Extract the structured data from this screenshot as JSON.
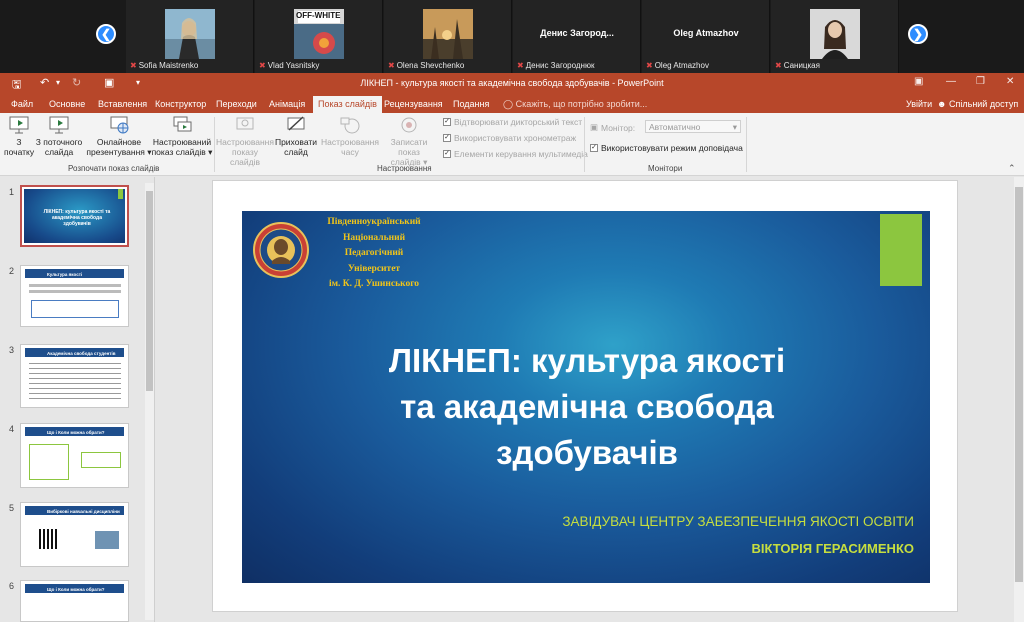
{
  "zoom": {
    "participants": [
      {
        "name": "Sofia Maistrenko",
        "muted": true,
        "photo": "woman-outdoors-photo"
      },
      {
        "name": "Vlad Yasnitsky",
        "muted": true,
        "photo": "off-white-flower-photo"
      },
      {
        "name": "Olena Shevchenko",
        "muted": true,
        "photo": "sunset-trees-photo"
      },
      {
        "name": "Денис Загороднюк",
        "display": "Денис  Загород...",
        "muted": true
      },
      {
        "name": "Oleg Atmazhov",
        "display": "Oleg Atmazhov",
        "muted": false
      },
      {
        "name": "Саницкая",
        "muted": true,
        "photo": "woman-portrait-photo"
      }
    ],
    "avatar_text": "OFF-WHITE"
  },
  "window": {
    "title": "ЛІКНЕП - культура якості та академічна свобода здобувачів  -  PowerPoint",
    "undo_icon": "undo-icon",
    "redo_icon": "redo-icon"
  },
  "tabs": [
    "Файл",
    "Основне",
    "Вставлення",
    "Конструктор",
    "Переходи",
    "Анімація",
    "Показ слайдів",
    "Рецензування",
    "Подання"
  ],
  "active_tab": "Показ слайдів",
  "tell_me": "Скажіть, що потрібно зробити...",
  "signin": "Увійти",
  "share": "Спільний доступ",
  "ribbon": {
    "start": {
      "from_beginning": [
        "З",
        "початку"
      ],
      "from_current": [
        "З поточного",
        "слайда"
      ],
      "online": [
        "Онлайнове",
        "презентування"
      ],
      "custom": [
        "Настроюваний",
        "показ слайдів"
      ],
      "group": "Розпочати показ слайдів"
    },
    "setup": {
      "setup_show": [
        "Настроювання",
        "показу слайдів"
      ],
      "hide_slide": [
        "Приховати",
        "слайд"
      ],
      "rehearse": [
        "Настроювання",
        "часу"
      ],
      "record": [
        "Записати показ",
        "слайдів"
      ],
      "play_narrations": "Відтворювати дикторський текст",
      "use_timings": "Використовувати хронометраж",
      "show_media": "Елементи керування мультимедіа",
      "group": "Настроювання"
    },
    "monitors": {
      "monitor_label": "Монітор:",
      "monitor_value": "Автоматично",
      "presenter_view": "Використовувати режим доповідача",
      "group": "Монітори"
    }
  },
  "thumbnails": [
    {
      "num": "1",
      "title": "ЛІКНЕП: культура якості та академічна свобода здобувачів"
    },
    {
      "num": "2",
      "title": "Культура якості"
    },
    {
      "num": "3",
      "title": "Академічна свобода студентів"
    },
    {
      "num": "4",
      "title": "Що і Коли можна обрати?"
    },
    {
      "num": "5",
      "title": "Вибіркові навчальні дисципліни"
    },
    {
      "num": "6",
      "title": "Що і Коли можна обрати?"
    }
  ],
  "slide": {
    "university": [
      "Південноукраїнський",
      "Національний",
      "Педагогічний",
      "Університет",
      "ім. К. Д. Ушинського"
    ],
    "title": [
      "ЛІКНЕП: культура якості",
      "та академічна свобода",
      "здобувачів"
    ],
    "subtitle": "ЗАВІДУВАЧ ЦЕНТРУ ЗАБЕЗПЕЧЕННЯ ЯКОСТІ ОСВІТИ",
    "author": "ВІКТОРІЯ ГЕРАСИМЕНКО"
  },
  "colors": {
    "ppt_accent": "#b7472a",
    "zoom_blue": "#2d8cff",
    "slide_green": "#8cc63f",
    "slide_gold": "#f0c419"
  }
}
